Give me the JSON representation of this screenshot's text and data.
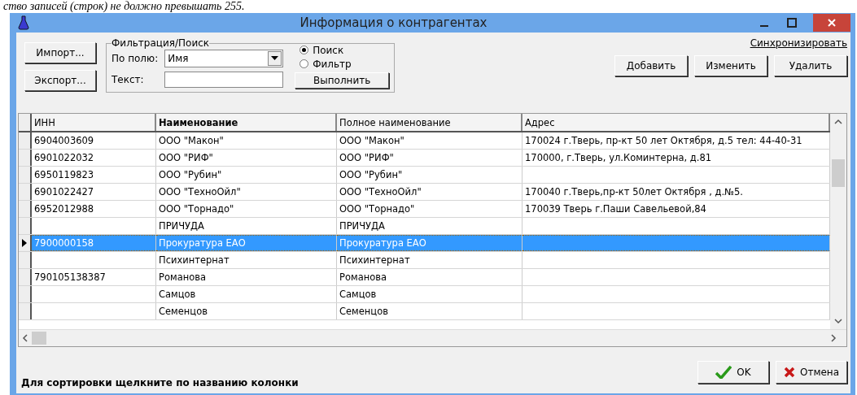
{
  "background_text": "ство записей (строк) не должно превышать 255.",
  "window": {
    "title": "Информация о контрагентах"
  },
  "toolbar": {
    "import_button": "Импорт...",
    "export_button": "Экспорт...",
    "filter_group": {
      "title": "Фильтрация/Поиск",
      "field_label": "По полю:",
      "field_value": "Имя",
      "text_label": "Текст:",
      "modes": [
        {
          "label": "Поиск",
          "selected": true
        },
        {
          "label": "Фильтр",
          "selected": false
        }
      ],
      "run_button": "Выполнить"
    },
    "sync_link": "Синхронизировать",
    "add_button": "Добавить",
    "edit_button": "Изменить",
    "delete_button": "Удалить"
  },
  "table": {
    "columns": [
      {
        "label": "ИНН",
        "bold": false
      },
      {
        "label": "Наименование",
        "bold": true
      },
      {
        "label": "Полное наименование",
        "bold": false
      },
      {
        "label": "Адрес",
        "bold": false
      }
    ],
    "rows": [
      {
        "selected": false,
        "cells": [
          "6904003609",
          "ООО \"Макон\"",
          "ООО \"Макон\"",
          "170024 г.Тверь, пр-кт 50 лет Октября, д.5 тел: 44-40-31"
        ]
      },
      {
        "selected": false,
        "cells": [
          "6901022032",
          "ООО \"РИФ\"",
          "ООО \"РИФ\"",
          "170000, г.Тверь, ул.Коминтерна, д.81"
        ]
      },
      {
        "selected": false,
        "cells": [
          "6950119823",
          "ООО \"Рубин\"",
          "ООО \"Рубин\"",
          ""
        ]
      },
      {
        "selected": false,
        "cells": [
          "6901022427",
          "ООО \"ТехноОйл\"",
          "ООО \"ТехноОйл\"",
          "170040 г.Тверь,пр-кт 50лет Октября , д.№5."
        ]
      },
      {
        "selected": false,
        "cells": [
          "6952012988",
          "ООО \"Торнадо\"",
          "ООО \"Торнадо\"",
          "170039  Тверь г.Паши Савельевой,84"
        ]
      },
      {
        "selected": false,
        "cells": [
          "",
          "ПРИЧУДА",
          "ПРИЧУДА",
          ""
        ]
      },
      {
        "selected": true,
        "cells": [
          "7900000158",
          "Прокуратура ЕАО",
          "Прокуратура ЕАО",
          ""
        ]
      },
      {
        "selected": false,
        "cells": [
          "",
          "Психинтернат",
          "Психинтернат",
          ""
        ]
      },
      {
        "selected": false,
        "cells": [
          "790105138387",
          "Романова",
          "Романова",
          ""
        ]
      },
      {
        "selected": false,
        "cells": [
          "",
          "Самцов",
          "Самцов",
          ""
        ]
      },
      {
        "selected": false,
        "cells": [
          "",
          "Семенцов",
          "Семенцов",
          ""
        ]
      }
    ]
  },
  "status_text": "Для сортировки щелкните по названию колонки",
  "ok_button": "OK",
  "cancel_button": "Отмена"
}
